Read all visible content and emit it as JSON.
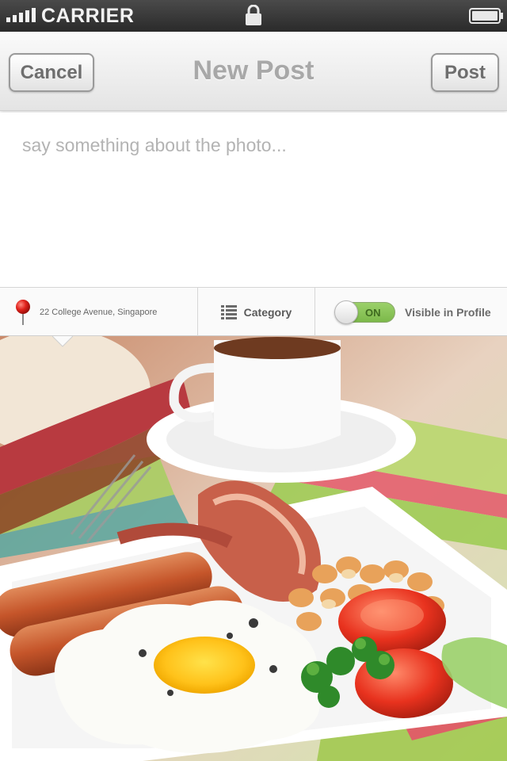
{
  "status_bar": {
    "carrier": "CARRIER",
    "signal_icon": "signal-bars-icon",
    "lock_icon": "lock-icon",
    "battery_icon": "battery-icon"
  },
  "nav": {
    "cancel_label": "Cancel",
    "title": "New Post",
    "post_label": "Post"
  },
  "caption": {
    "placeholder": "say something about the photo...",
    "value": ""
  },
  "options": {
    "location": "22 College Avenue, Singapore",
    "location_icon": "map-pin-icon",
    "category_label": "Category",
    "category_icon": "list-icon",
    "toggle_state": "ON",
    "visibility_label": "Visible in Profile"
  },
  "photo": {
    "subject": "breakfast-photo"
  },
  "colors": {
    "status_bar_bg": "#2e2e2e",
    "toggle_on": "#8cc45a",
    "pin_red": "#d9201b"
  }
}
